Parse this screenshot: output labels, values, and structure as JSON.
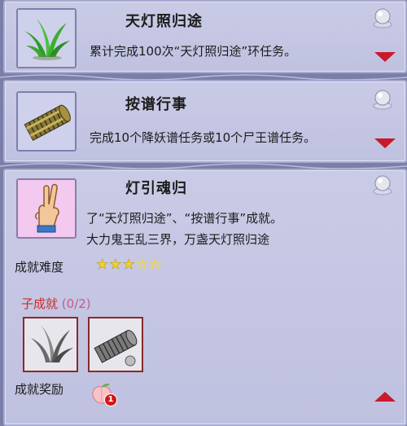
{
  "achievements": [
    {
      "title": "天灯照归途",
      "description": "累计完成100次“天灯照归途”环任务。",
      "icon": "grass-icon",
      "expanded": false
    },
    {
      "title": "按谱行事",
      "description": "完成10个降妖谱任务或10个尸王谱任务。",
      "icon": "bamboo-scroll-icon",
      "expanded": false
    },
    {
      "title": "灯引魂归",
      "description_line1": "了“天灯照归途”、“按谱行事”成就。",
      "description_line2": "大力鬼王乱三界，万盏天灯照归途",
      "icon": "victory-hand-icon",
      "expanded": true,
      "difficulty_label": "成就难度",
      "difficulty_stars": 3,
      "difficulty_max": 5,
      "star_on": "★",
      "star_off": "☆",
      "sub_achievements_label": "子成就",
      "sub_achievements_progress": "(0/2)",
      "sub_achievements": [
        "grass-icon",
        "bamboo-scroll-icon"
      ],
      "reward_label": "成就奖励",
      "reward_icon": "peach-icon",
      "reward_count": "1"
    }
  ],
  "colors": {
    "arrow": "#c81a2a",
    "sub_title": "#d22a2a",
    "star": "#f2d22a"
  }
}
